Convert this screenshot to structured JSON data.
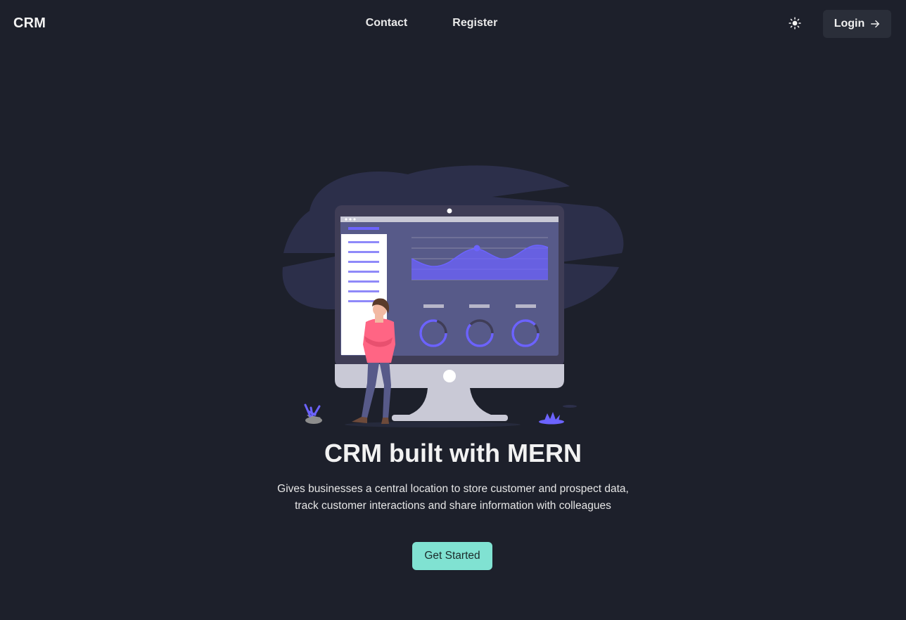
{
  "nav": {
    "brand": "CRM",
    "links": [
      "Contact",
      "Register"
    ],
    "theme_icon": "sun-icon",
    "login_label": "Login",
    "login_icon": "arrow-right-icon"
  },
  "hero": {
    "title": "CRM built with MERN",
    "description": "Gives businesses a central location to store customer and prospect data, track customer interactions and share information with colleagues",
    "cta_label": "Get Started",
    "illustration_icon": "crm-dashboard-illustration"
  },
  "colors": {
    "background": "#1d202b",
    "login_button": "#2a2e39",
    "cta": "#80e2d2",
    "accent": "#6c63ff"
  }
}
